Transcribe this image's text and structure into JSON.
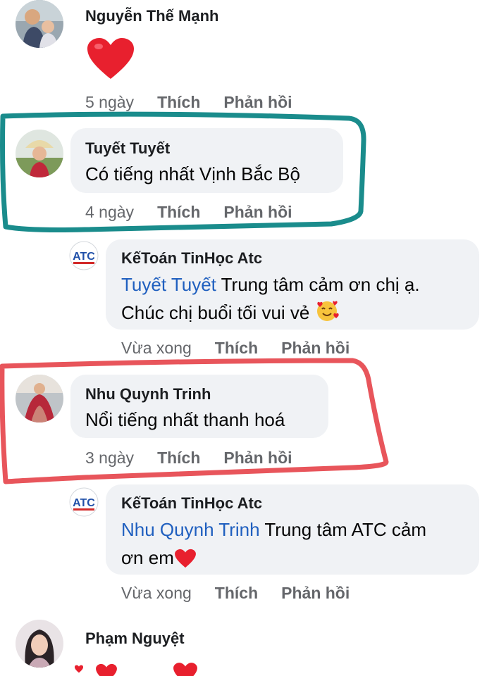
{
  "comments": [
    {
      "author": "Nguyễn Thế Mạnh",
      "time": "5 ngày",
      "like": "Thích",
      "reply": "Phản hồi"
    },
    {
      "author": "Tuyết Tuyết",
      "text": "Có tiếng nhất Vịnh Bắc Bộ",
      "time": "4 ngày",
      "like": "Thích",
      "reply": "Phản hồi",
      "highlight_color": "#1a8c8c"
    },
    {
      "author": "KếToán TinHọc Atc",
      "mention": "Tuyết Tuyết",
      "text_line1": " Trung tâm cảm ơn chị ạ.",
      "text_line2": "Chúc chị buổi tối vui vẻ",
      "emoji": "smiling-face-with-hearts",
      "time": "Vừa xong",
      "like": "Thích",
      "reply": "Phản hồi",
      "is_reply": true
    },
    {
      "author": "Nhu Quynh Trinh",
      "text": "Nổi tiếng nhất thanh hoá",
      "time": "3 ngày",
      "like": "Thích",
      "reply": "Phản hồi",
      "highlight_color": "#e8555b"
    },
    {
      "author": "KếToán TinHọc Atc",
      "mention": "Nhu Quynh Trinh",
      "text_line1": " Trung tâm ATC cảm",
      "text_line2": "ơn em",
      "emoji": "red-heart",
      "time": "Vừa xong",
      "like": "Thích",
      "reply": "Phản hồi",
      "is_reply": true
    },
    {
      "author": "Phạm Nguyệt"
    }
  ],
  "colors": {
    "bubble": "#f0f2f5",
    "mention": "#1f5fbf",
    "meta": "#65676b",
    "heart": "#e8202e"
  }
}
